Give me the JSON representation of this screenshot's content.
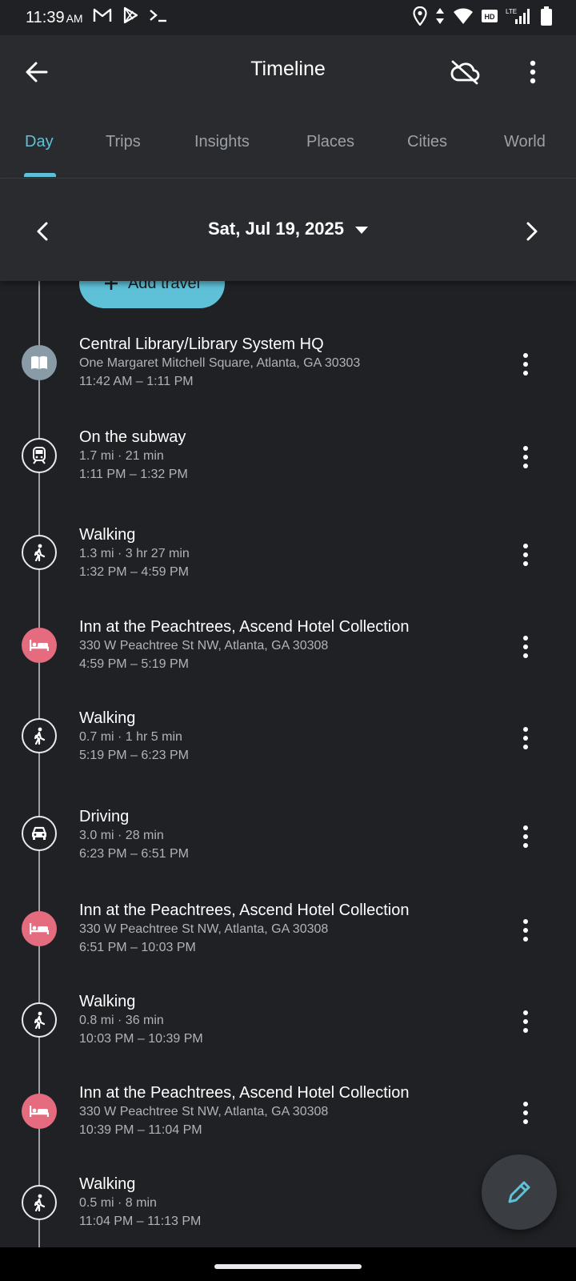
{
  "status_bar": {
    "time": "11:39",
    "ampm": "AM"
  },
  "app_bar": {
    "title": "Timeline"
  },
  "tabs": [
    {
      "label": "Day",
      "active": true
    },
    {
      "label": "Trips"
    },
    {
      "label": "Insights"
    },
    {
      "label": "Places"
    },
    {
      "label": "Cities"
    },
    {
      "label": "World"
    }
  ],
  "date_nav": {
    "date": "Sat, Jul 19, 2025"
  },
  "add_travel": {
    "label": "Add travel"
  },
  "entries": [
    {
      "icon": "library-icon",
      "title": "Central Library/Library System HQ",
      "line2": "One Margaret Mitchell Square, Atlanta, GA 30303",
      "line3": "11:42 AM – 1:11 PM"
    },
    {
      "icon": "subway-icon",
      "title": "On the subway",
      "line2": "1.7 mi · 21 min",
      "line3": "1:11 PM – 1:32 PM"
    },
    {
      "icon": "walking-icon",
      "title": "Walking",
      "line2": "1.3 mi · 3 hr 27 min",
      "line3": "1:32 PM – 4:59 PM"
    },
    {
      "icon": "hotel-icon",
      "title": "Inn at the Peachtrees, Ascend Hotel Collection",
      "line2": "330 W Peachtree St NW, Atlanta, GA 30308",
      "line3": "4:59 PM – 5:19 PM"
    },
    {
      "icon": "walking-icon",
      "title": "Walking",
      "line2": "0.7 mi · 1 hr 5 min",
      "line3": "5:19 PM – 6:23 PM"
    },
    {
      "icon": "car-icon",
      "title": "Driving",
      "line2": "3.0 mi · 28 min",
      "line3": "6:23 PM – 6:51 PM"
    },
    {
      "icon": "hotel-icon",
      "title": "Inn at the Peachtrees, Ascend Hotel Collection",
      "line2": "330 W Peachtree St NW, Atlanta, GA 30308",
      "line3": "6:51 PM – 10:03 PM"
    },
    {
      "icon": "walking-icon",
      "title": "Walking",
      "line2": "0.8 mi · 36 min",
      "line3": "10:03 PM – 10:39 PM"
    },
    {
      "icon": "hotel-icon",
      "title": "Inn at the Peachtrees, Ascend Hotel Collection",
      "line2": "330 W Peachtree St NW, Atlanta, GA 30308",
      "line3": "10:39 PM – 11:04 PM"
    },
    {
      "icon": "walking-icon",
      "title": "Walking",
      "line2": "0.5 mi · 8 min",
      "line3": "11:04 PM – 11:13 PM"
    }
  ],
  "colors": {
    "accent": "#5ec1d8",
    "hotel": "#e56b7f",
    "library": "#8a9ba8",
    "background": "#202124"
  }
}
